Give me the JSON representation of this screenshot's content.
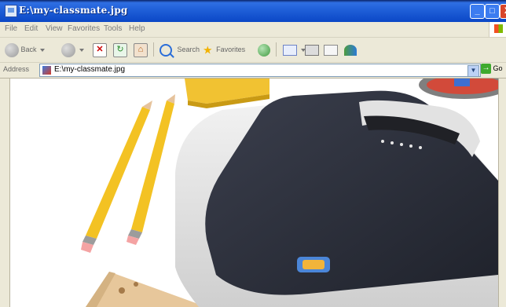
{
  "window": {
    "title": "E:\\my-classmate.jpg",
    "controls": {
      "minimize": "_",
      "maximize": "□",
      "close": "X"
    }
  },
  "menu": {
    "items": [
      "File",
      "Edit",
      "View",
      "Favorites",
      "Tools",
      "Help"
    ]
  },
  "toolbar": {
    "back_label": "Back",
    "search_label": "Search",
    "favorites_label": "Favorites"
  },
  "address": {
    "label": "Address",
    "value": "E:\\my-classmate.jpg",
    "go_label": "Go"
  },
  "colors": {
    "titlebar": "#1f5fd8",
    "chrome": "#ece9d8",
    "close_button": "#d8462a"
  },
  "icons": [
    "back-arrow-icon",
    "forward-arrow-icon",
    "stop-icon",
    "refresh-icon",
    "home-icon",
    "search-icon",
    "favorites-star-icon",
    "media-icon",
    "mail-icon",
    "print-icon",
    "edit-icon",
    "messenger-icon"
  ]
}
